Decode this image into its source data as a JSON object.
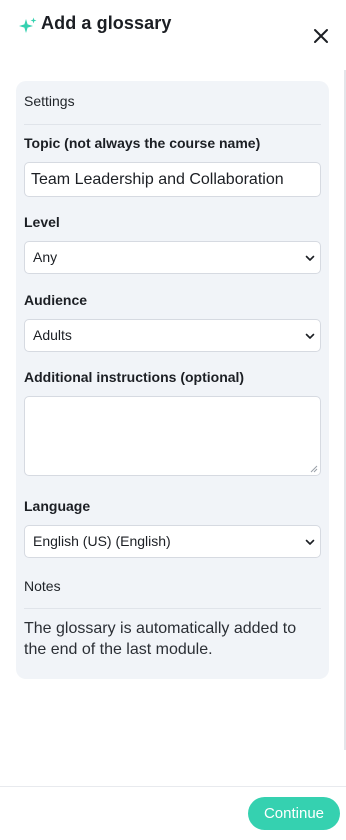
{
  "header": {
    "title": "Add a glossary",
    "icons": {
      "title_icon": "sparkle-icon",
      "close_icon": "close-icon"
    }
  },
  "settings": {
    "section_title": "Settings",
    "topic": {
      "label": "Topic (not always the course name)",
      "value": "Team Leadership and Collaboration"
    },
    "level": {
      "label": "Level",
      "selected": "Any"
    },
    "audience": {
      "label": "Audience",
      "selected": "Adults"
    },
    "instructions": {
      "label": "Additional instructions (optional)",
      "value": ""
    },
    "language": {
      "label": "Language",
      "selected": "English (US) (English)"
    },
    "notes": {
      "title": "Notes",
      "text": "The glossary is automatically added to the end of the last module."
    }
  },
  "footer": {
    "continue_label": "Continue"
  },
  "colors": {
    "accent": "#35d1b0",
    "panel_background": "#f1f4f8",
    "text": "#1c1f24"
  }
}
